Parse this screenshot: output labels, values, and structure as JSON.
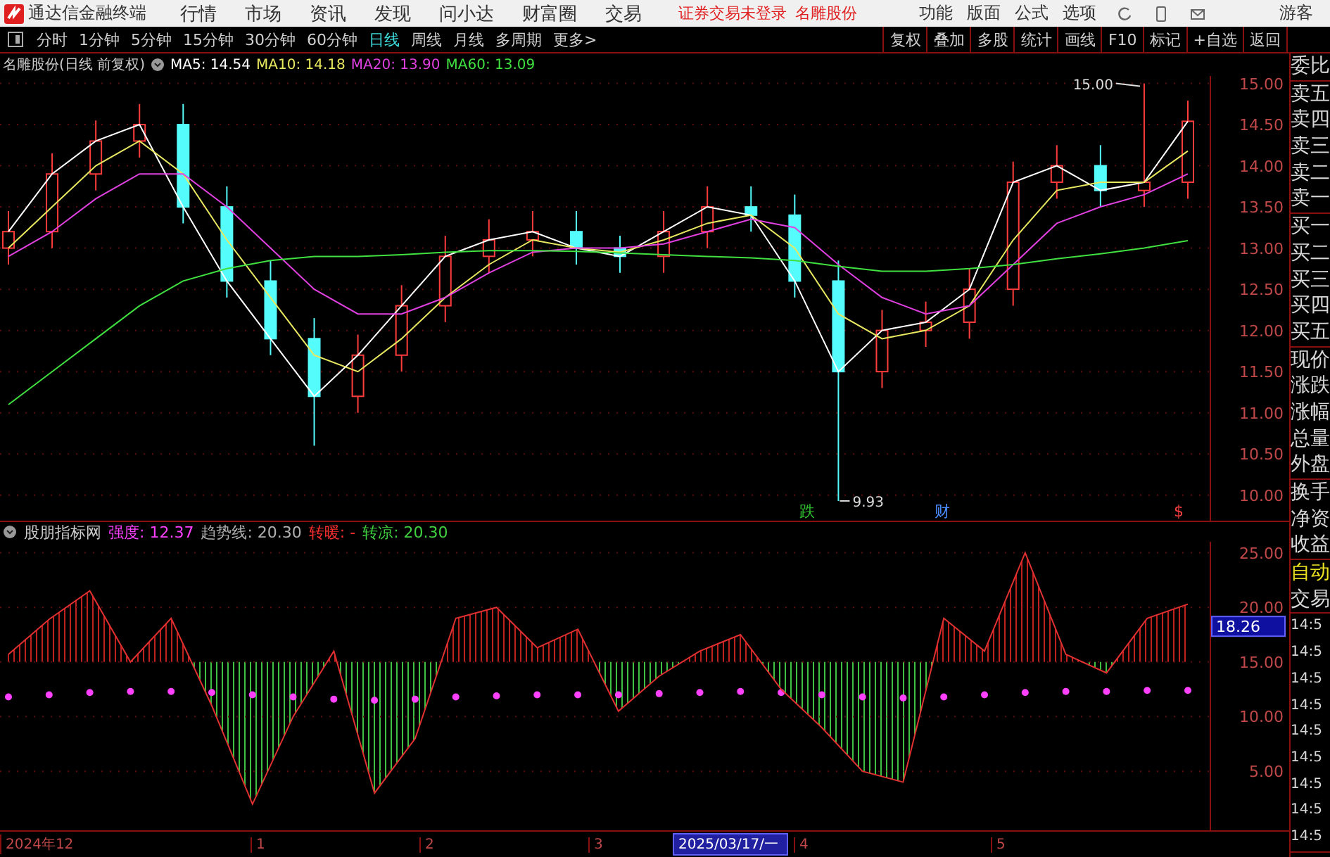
{
  "menu_bar": {
    "app_title": "通达信金融终端",
    "items": [
      "行情",
      "市场",
      "资讯",
      "发现",
      "问小达",
      "财富圈",
      "交易"
    ],
    "notices": [
      "证券交易未登录",
      "名雕股份"
    ],
    "right_items": [
      "功能",
      "版面",
      "公式",
      "选项"
    ],
    "user": "游客"
  },
  "toolbar": {
    "periods": [
      {
        "label": "分时",
        "selected": false
      },
      {
        "label": "1分钟",
        "selected": false
      },
      {
        "label": "5分钟",
        "selected": false
      },
      {
        "label": "15分钟",
        "selected": false
      },
      {
        "label": "30分钟",
        "selected": false
      },
      {
        "label": "60分钟",
        "selected": false
      },
      {
        "label": "日线",
        "selected": true
      },
      {
        "label": "周线",
        "selected": false
      },
      {
        "label": "月线",
        "selected": false
      },
      {
        "label": "多周期",
        "selected": false
      },
      {
        "label": "更多>",
        "selected": false
      }
    ],
    "buttons": [
      "复权",
      "叠加",
      "多股",
      "统计",
      "画线",
      "F10",
      "标记",
      "+自选",
      "返回"
    ]
  },
  "price_chart": {
    "title": "名雕股份(日线 前复权)",
    "legend": [
      {
        "label": "MA5: 14.54",
        "color": "#ffffff"
      },
      {
        "label": "MA10: 14.18",
        "color": "#e8e860"
      },
      {
        "label": "MA20: 13.90",
        "color": "#e040e0"
      },
      {
        "label": "MA60: 13.09",
        "color": "#40e040"
      }
    ],
    "high_label": "15.00",
    "low_label": "9.93",
    "events": [
      {
        "text": "跌",
        "color": "#30c030"
      },
      {
        "text": "财",
        "color": "#4a8cff"
      },
      {
        "text": "$",
        "color": "#ff4040"
      }
    ],
    "chart_data": {
      "type": "candlestick",
      "grid": true,
      "ylim": [
        9.69,
        15.09
      ],
      "yticks": [
        {
          "value": 10,
          "label": "10.00"
        },
        {
          "value": 10.5,
          "label": "10.50"
        },
        {
          "value": 11,
          "label": "11.00"
        },
        {
          "value": 11.5,
          "label": "11.50"
        },
        {
          "value": 12,
          "label": "12.00"
        },
        {
          "value": 12.5,
          "label": "12.50"
        },
        {
          "value": 13,
          "label": "13.00"
        },
        {
          "value": 13.5,
          "label": "13.50"
        },
        {
          "value": 14,
          "label": "14.00"
        },
        {
          "value": 14.5,
          "label": "14.50"
        },
        {
          "value": 15,
          "label": "15.00"
        }
      ],
      "ohlc": [
        [
          13.0,
          13.45,
          12.8,
          13.2
        ],
        [
          13.2,
          14.15,
          13.0,
          13.9
        ],
        [
          13.9,
          14.55,
          13.7,
          14.3
        ],
        [
          14.3,
          14.75,
          14.1,
          14.5
        ],
        [
          14.5,
          14.75,
          13.3,
          13.5
        ],
        [
          13.5,
          13.75,
          12.4,
          12.6
        ],
        [
          12.6,
          12.85,
          11.7,
          11.9
        ],
        [
          11.9,
          12.15,
          10.6,
          11.2
        ],
        [
          11.2,
          11.95,
          11.0,
          11.7
        ],
        [
          11.7,
          12.55,
          11.5,
          12.3
        ],
        [
          12.3,
          13.15,
          12.1,
          12.9
        ],
        [
          12.9,
          13.35,
          12.7,
          13.1
        ],
        [
          13.1,
          13.45,
          12.9,
          13.2
        ],
        [
          13.2,
          13.45,
          12.8,
          13.0
        ],
        [
          13.0,
          13.15,
          12.7,
          12.9
        ],
        [
          12.9,
          13.45,
          12.7,
          13.2
        ],
        [
          13.2,
          13.75,
          13.0,
          13.5
        ],
        [
          13.5,
          13.75,
          13.2,
          13.4
        ],
        [
          13.4,
          13.65,
          12.4,
          12.6
        ],
        [
          12.6,
          12.85,
          9.93,
          11.5
        ],
        [
          11.5,
          12.25,
          11.3,
          12.0
        ],
        [
          12.0,
          12.35,
          11.8,
          12.1
        ],
        [
          12.1,
          12.75,
          11.9,
          12.5
        ],
        [
          12.5,
          14.05,
          12.3,
          13.8
        ],
        [
          13.8,
          14.25,
          13.6,
          14.0
        ],
        [
          14.0,
          14.25,
          13.5,
          13.7
        ],
        [
          13.7,
          15.0,
          13.5,
          13.8
        ],
        [
          13.8,
          14.79,
          13.6,
          14.54
        ]
      ],
      "series": [
        {
          "type": "line",
          "color": "#ffffff",
          "values": [
            13.2,
            13.9,
            14.3,
            14.5,
            13.5,
            12.6,
            11.9,
            11.2,
            11.7,
            12.3,
            12.9,
            13.1,
            13.2,
            13.0,
            12.9,
            13.2,
            13.5,
            13.4,
            12.6,
            11.5,
            12.0,
            12.1,
            12.5,
            13.8,
            14.0,
            13.7,
            13.8,
            14.54
          ]
        },
        {
          "type": "line",
          "color": "#e8e860",
          "values": [
            13.0,
            13.5,
            14.0,
            14.3,
            13.9,
            13.1,
            12.4,
            11.7,
            11.5,
            11.9,
            12.4,
            12.8,
            13.1,
            13.0,
            12.95,
            13.1,
            13.3,
            13.4,
            13.0,
            12.2,
            11.9,
            12.0,
            12.3,
            13.1,
            13.7,
            13.8,
            13.8,
            14.18
          ]
        },
        {
          "type": "line",
          "color": "#e040e0",
          "values": [
            12.9,
            13.2,
            13.6,
            13.9,
            13.9,
            13.5,
            13.0,
            12.5,
            12.2,
            12.2,
            12.4,
            12.7,
            12.95,
            13.0,
            13.0,
            13.05,
            13.2,
            13.35,
            13.25,
            12.8,
            12.4,
            12.2,
            12.3,
            12.8,
            13.3,
            13.5,
            13.65,
            13.9
          ]
        },
        {
          "type": "line",
          "color": "#40e040",
          "values": [
            11.1,
            11.5,
            11.9,
            12.3,
            12.6,
            12.75,
            12.85,
            12.9,
            12.9,
            12.92,
            12.95,
            12.97,
            12.97,
            12.96,
            12.94,
            12.92,
            12.9,
            12.88,
            12.85,
            12.78,
            12.72,
            12.72,
            12.75,
            12.8,
            12.87,
            12.93,
            13.0,
            13.09
          ]
        }
      ]
    }
  },
  "indicator": {
    "title": "股朋指标网",
    "legend": [
      {
        "label": "强度: 12.37",
        "color": "#ff40ff"
      },
      {
        "label": "趋势线: 20.30",
        "color": "#b0b0b0"
      },
      {
        "label": "转暖: -",
        "color": "#ff3030"
      },
      {
        "label": "转凉: 20.30",
        "color": "#40d040"
      }
    ],
    "cursor_value": "18.26",
    "chart_data": {
      "type": "line",
      "grid": true,
      "ylim": [
        -0.4,
        26
      ],
      "yticks": [
        {
          "value": 5,
          "label": "5.00"
        },
        {
          "value": 10,
          "label": "10.00"
        },
        {
          "value": 15,
          "label": "15.00"
        },
        {
          "value": 20,
          "label": "20.00"
        },
        {
          "value": 25,
          "label": "25.00"
        }
      ],
      "series": [
        {
          "type": "scatter",
          "color": "#ff40ff",
          "values": [
            11.8,
            12,
            12.2,
            12.3,
            12.3,
            12.2,
            12,
            11.8,
            11.6,
            11.5,
            11.6,
            11.8,
            11.9,
            12,
            12,
            12,
            12.1,
            12.2,
            12.3,
            12.2,
            12,
            11.8,
            11.7,
            11.8,
            12,
            12.2,
            12.3,
            12.3,
            12.4,
            12.4
          ]
        },
        {
          "type": "line",
          "color": "#e03030",
          "values": [
            15.7,
            18.9,
            21.5,
            15,
            19,
            11,
            2,
            10,
            16,
            3,
            8,
            19,
            20,
            16.3,
            18,
            10.5,
            13.7,
            16,
            17.5,
            12.5,
            9,
            5,
            4,
            19,
            16,
            25,
            15.7,
            14,
            19,
            20.3
          ]
        }
      ]
    }
  },
  "date_axis": [
    {
      "label": "2024年12",
      "selected": false
    },
    {
      "label": "1",
      "selected": false
    },
    {
      "label": "2",
      "selected": false
    },
    {
      "label": "3",
      "selected": false
    },
    {
      "label": "2025/03/17/一",
      "selected": true
    },
    {
      "label": "4",
      "selected": false
    },
    {
      "label": "5",
      "selected": false
    }
  ],
  "side_panel": {
    "groups": [
      [
        {
          "label": "委比"
        }
      ],
      [
        {
          "label": "卖五"
        },
        {
          "label": "卖四"
        },
        {
          "label": "卖三"
        },
        {
          "label": "卖二"
        },
        {
          "label": "卖一"
        }
      ],
      [
        {
          "label": "买一"
        },
        {
          "label": "买二"
        },
        {
          "label": "买三"
        },
        {
          "label": "买四"
        },
        {
          "label": "买五"
        }
      ],
      [
        {
          "label": "现价"
        },
        {
          "label": "涨跌"
        },
        {
          "label": "涨幅"
        },
        {
          "label": "总量"
        },
        {
          "label": "外盘"
        }
      ],
      [
        {
          "label": "换手"
        },
        {
          "label": "净资"
        },
        {
          "label": "收益"
        }
      ],
      [
        {
          "label": "自动",
          "highlighted": true
        },
        {
          "label": "交易",
          "highlighted": false
        }
      ],
      [
        {
          "label": "14:5"
        },
        {
          "label": "14:5"
        },
        {
          "label": "14:5"
        },
        {
          "label": "14:5"
        },
        {
          "label": "14:5"
        },
        {
          "label": "14:5"
        },
        {
          "label": "14:5"
        },
        {
          "label": "14:5"
        },
        {
          "label": "14:5"
        }
      ]
    ]
  }
}
